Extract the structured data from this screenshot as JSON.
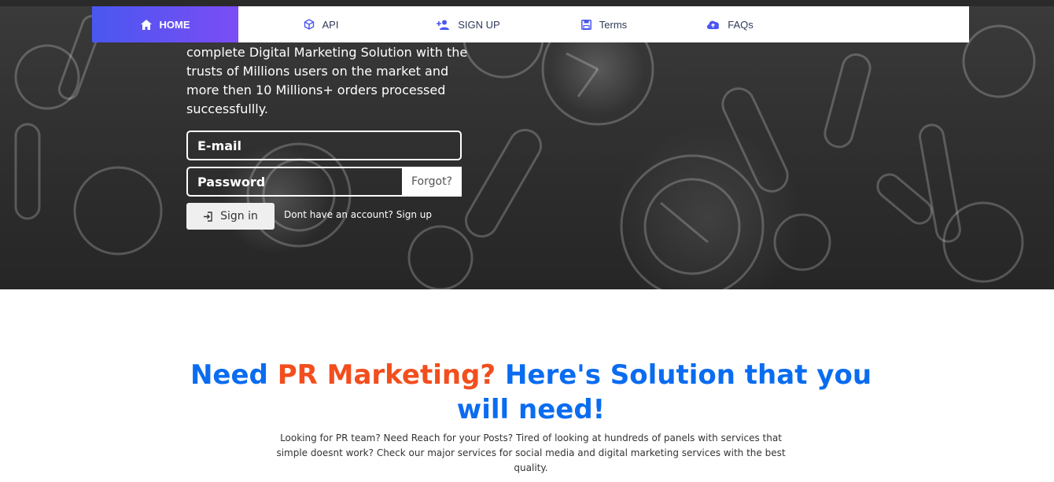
{
  "nav": {
    "home": "HOME",
    "api": "API",
    "signup": "SIGN UP",
    "terms": "Terms",
    "faqs": "FAQs"
  },
  "hero": {
    "description": "complete Digital Marketing Solution with the trusts of Millions users on the market and more then 10 Millions+ orders processed successfullly.",
    "email_placeholder": "E-mail",
    "password_placeholder": "Password",
    "forgot": "Forgot?",
    "signin": "Sign in",
    "no_account": "Dont have an account?",
    "signup_link": "Sign up"
  },
  "section": {
    "headline_part1": "Need ",
    "headline_accent": "PR Marketing?",
    "headline_part2": " Here's Solution that you will need!",
    "body": "Looking for PR team? Need Reach for your Posts? Tired of looking at hundreds of panels with services that simple doesnt work? Check our major services for social media and digital marketing services with the best quality."
  },
  "colors": {
    "accent_blue": "#0a6cf0",
    "accent_orange": "#f24e1e",
    "nav_gradient_start": "#4a57f0",
    "nav_gradient_end": "#7b4df5",
    "icon_color": "#4a57f0"
  }
}
